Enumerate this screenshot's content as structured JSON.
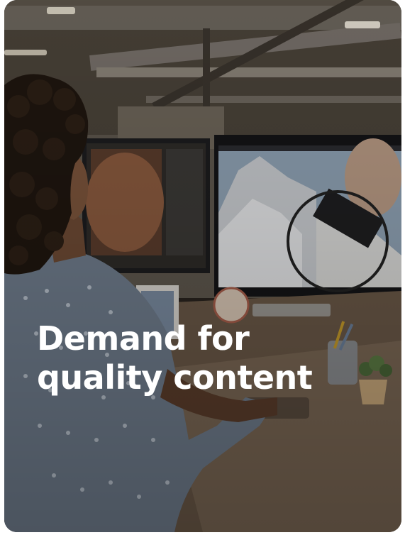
{
  "card": {
    "headline_line1": "Demand for",
    "headline_line2": "quality content",
    "image_subject": "person-at-dual-monitor-workstation",
    "colors": {
      "text": "#ffffff",
      "overlay": "#000000"
    }
  }
}
